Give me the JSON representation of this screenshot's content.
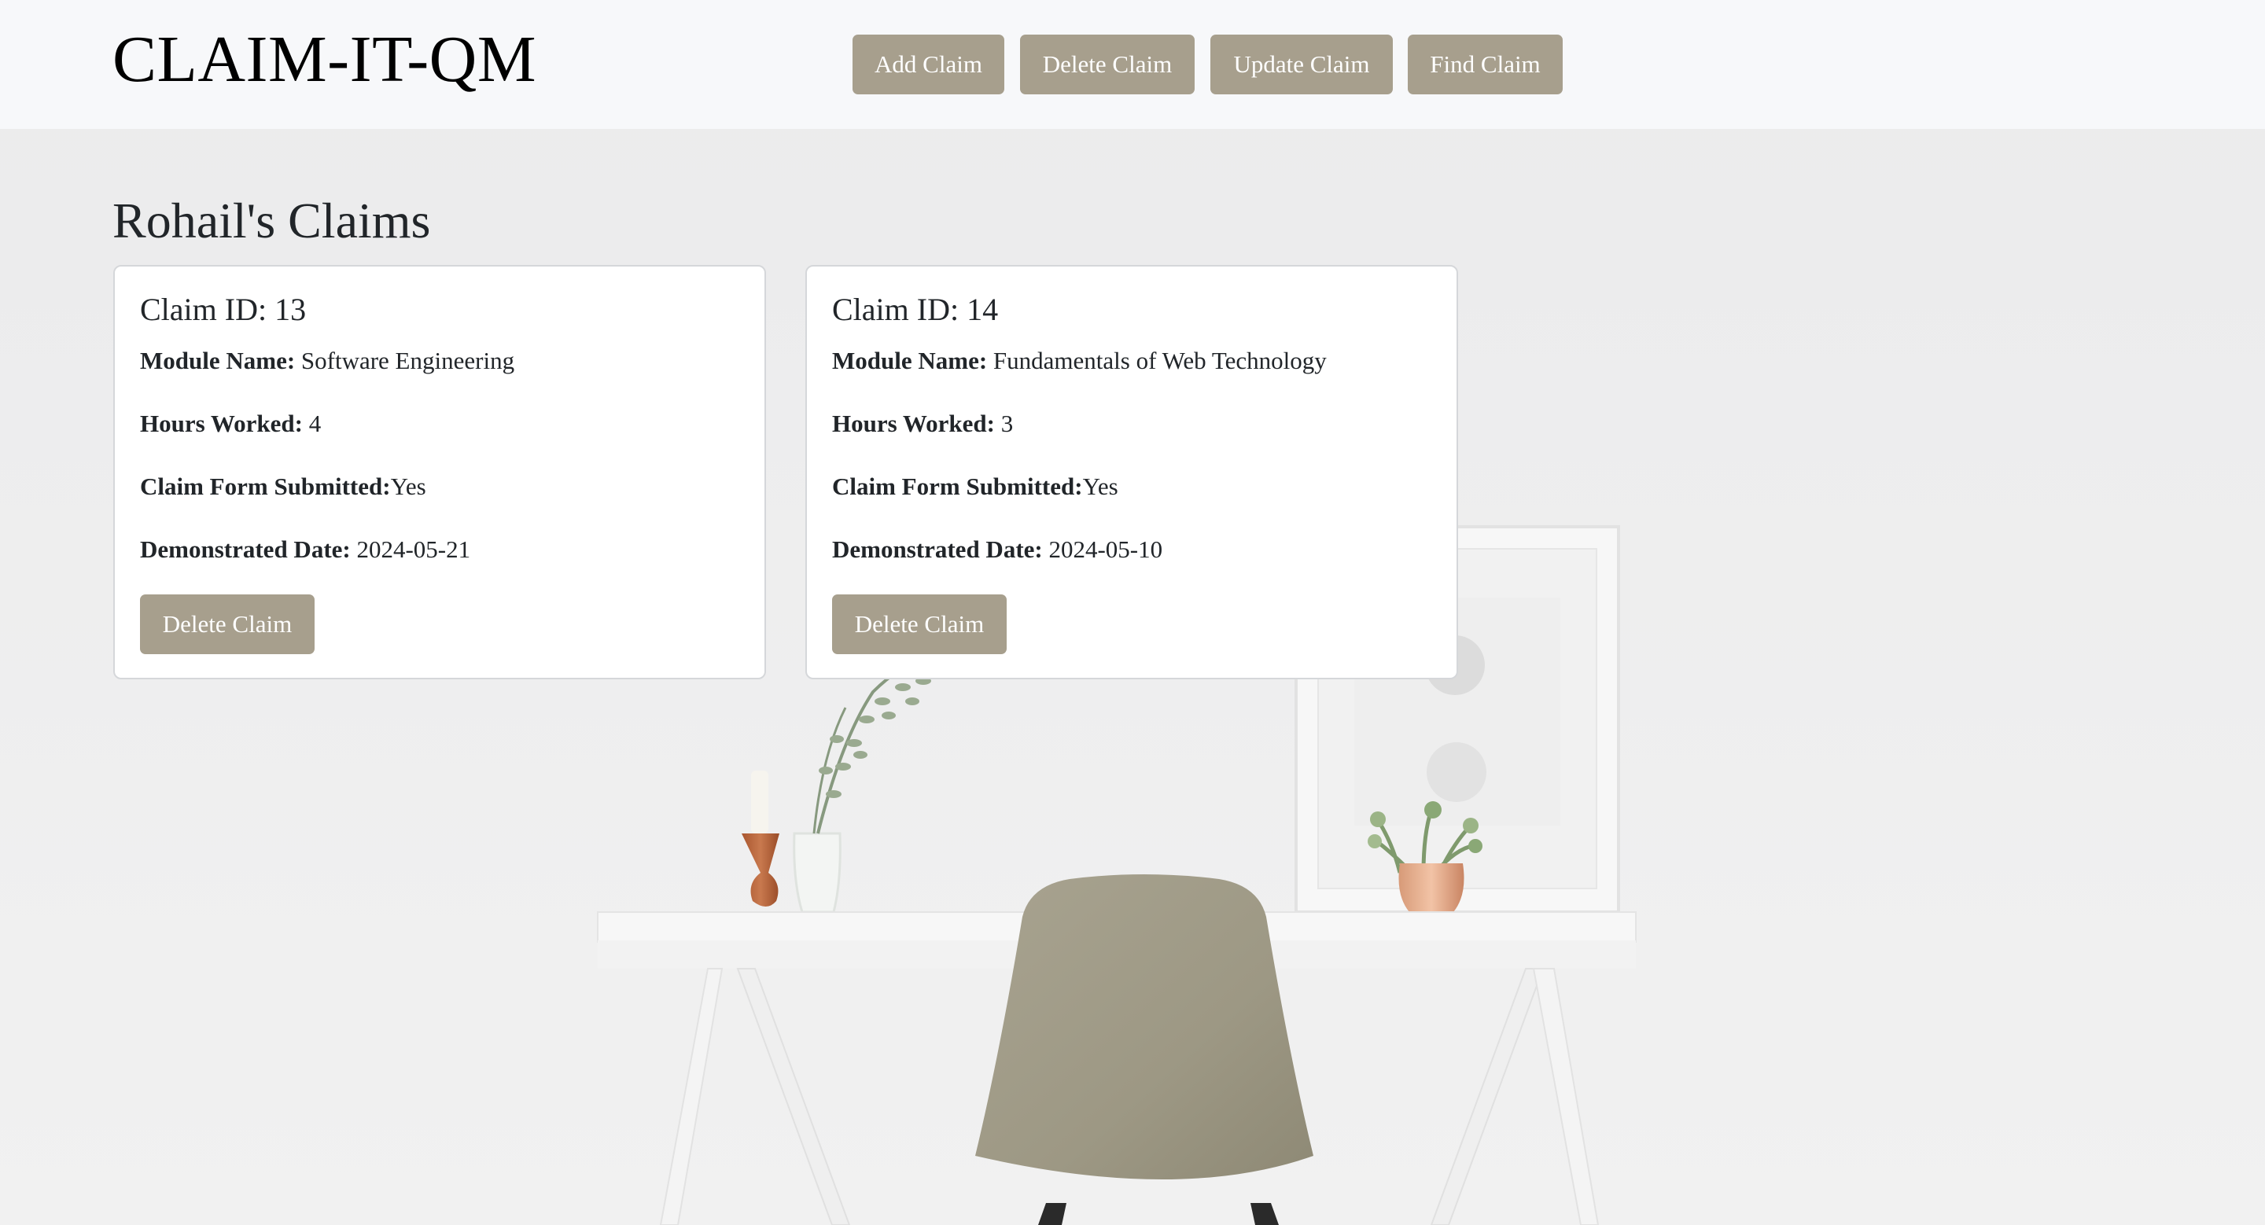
{
  "app": {
    "title": "CLAIM-IT-QM"
  },
  "nav": {
    "add_label": "Add Claim",
    "delete_label": "Delete Claim",
    "update_label": "Update Claim",
    "find_label": "Find Claim"
  },
  "page": {
    "title": "Rohail's Claims"
  },
  "labels": {
    "module": "Module Name:",
    "hours": "Hours Worked:",
    "form": "Claim Form Submitted:",
    "date": "Demonstrated Date:"
  },
  "claims": [
    {
      "id_text": "Claim ID: 13",
      "module": "Software Engineering",
      "hours": "4",
      "form_submitted": "Yes",
      "date": "2024-05-21",
      "delete_label": "Delete Claim"
    },
    {
      "id_text": "Claim ID: 14",
      "module": "Fundamentals of Web Technology",
      "hours": "3",
      "form_submitted": "Yes",
      "date": "2024-05-10",
      "delete_label": "Delete Claim"
    }
  ],
  "colors": {
    "button_bg": "#a79f8d",
    "navbar_bg": "#f7f8fa",
    "card_bg": "#ffffff"
  }
}
